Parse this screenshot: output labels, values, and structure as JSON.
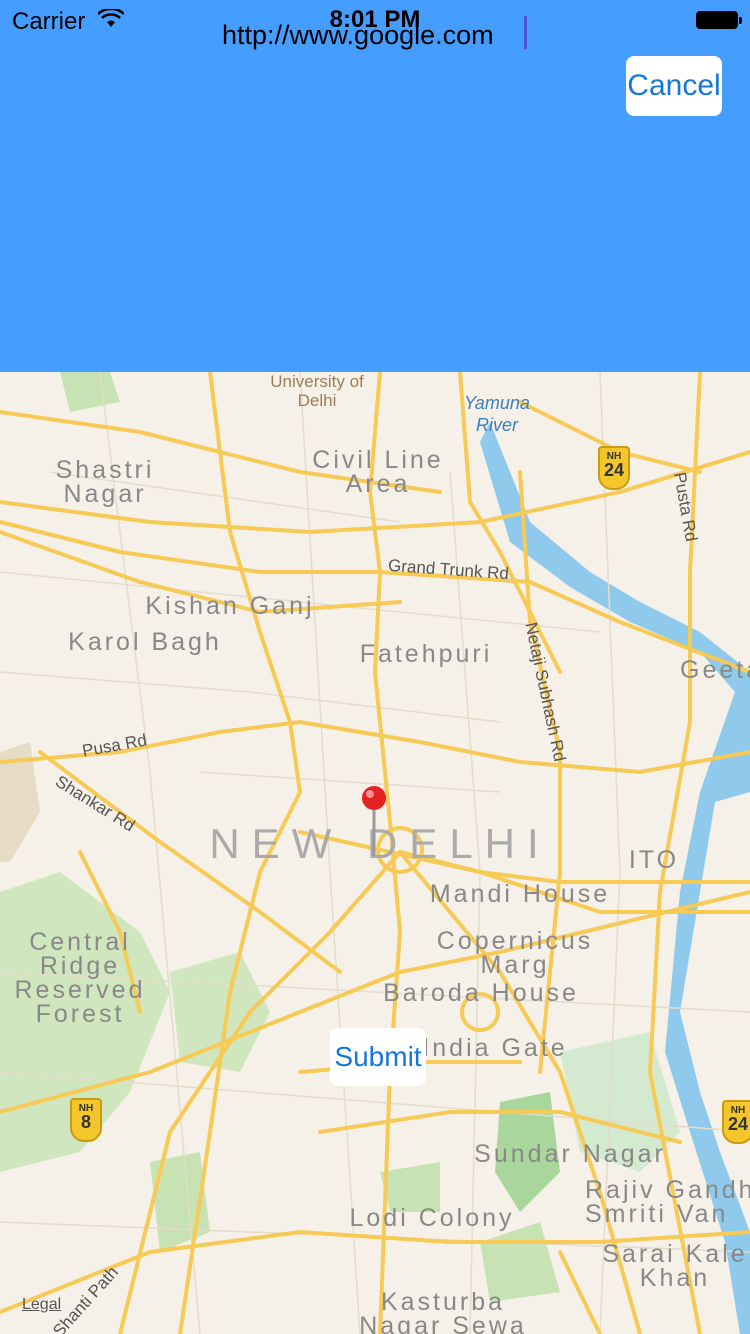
{
  "status_bar": {
    "carrier": "Carrier",
    "time": "8:01 PM"
  },
  "header": {
    "url_value": "http://www.google.com",
    "cancel_label": "Cancel"
  },
  "map": {
    "areas": {
      "shastri": "Shastri Nagar",
      "civil": "Civil Line Area",
      "kishan": "Kishan Ganj",
      "karol": "Karol Bagh",
      "fatehpuri": "Fatehpuri",
      "newdelhi": "NEW DELHI",
      "mandi": "Mandi House",
      "copernicus": "Copernicus Marg",
      "baroda": "Baroda House",
      "india_gate": "India Gate",
      "central_ridge": "Central Ridge Reserved Forest",
      "sundar": "Sundar Nagar",
      "rajiv": "Rajiv Gandhi Smriti Van",
      "lodi": "Lodi Colony",
      "sarai": "Sarai Kale Khan",
      "kasturba": "Kasturba Nagar Sewa",
      "ito": "ITO",
      "geeta": "Geeta"
    },
    "roads": {
      "grand_trunk": "Grand Trunk Rd",
      "netaji": "Netaji Subhash Rd",
      "pusta": "Pusta Rd",
      "pusa": "Pusa Rd",
      "shankar": "Shankar Rd",
      "shanti": "Shanti Path"
    },
    "river": "Yamuna River",
    "university": "University of Delhi",
    "highway_prefix": "NH",
    "highways": [
      "24",
      "8",
      "24"
    ],
    "legal": "Legal",
    "icons": {
      "pin": "red-pin-icon",
      "shield": "highway-shield-icon"
    }
  },
  "actions": {
    "submit_label": "Submit"
  }
}
